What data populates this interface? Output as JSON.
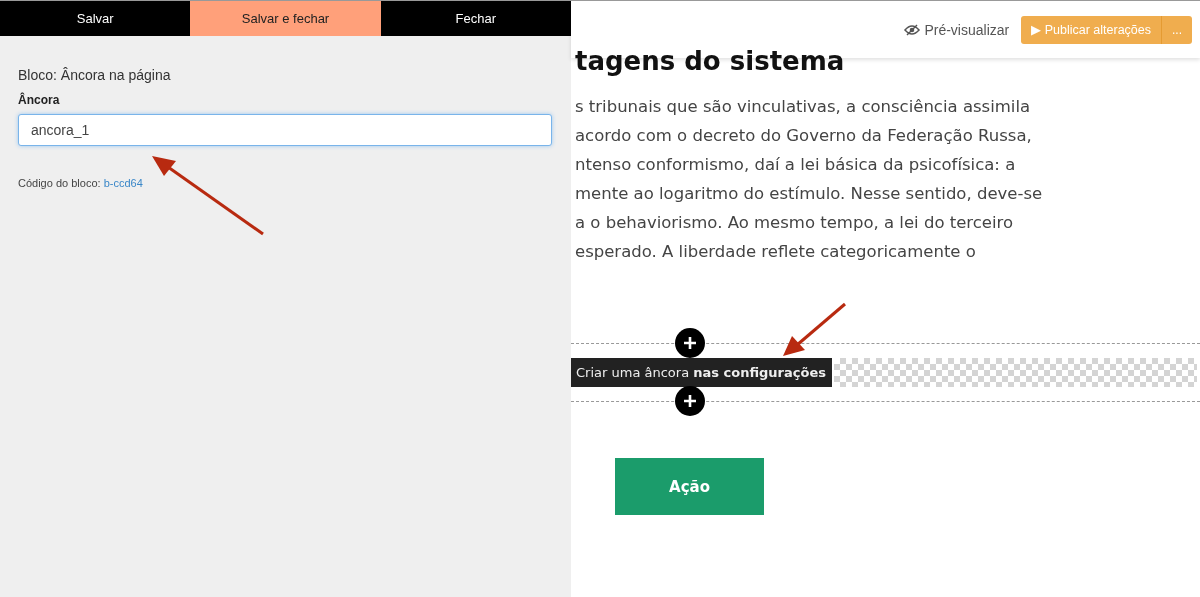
{
  "panel": {
    "tabs": [
      {
        "label": "Salvar",
        "selected": false
      },
      {
        "label": "Salvar e fechar",
        "selected": true
      },
      {
        "label": "Fechar",
        "selected": false
      }
    ],
    "block_title": "Bloco: Âncora na página",
    "field": {
      "label": "Âncora",
      "value": "ancora_1"
    },
    "code_label": "Código do bloco:",
    "code_link": "b-ccd64"
  },
  "toolbar": {
    "preview": "Pré-visualizar",
    "publish": "▶ Publicar alterações",
    "more": "..."
  },
  "page": {
    "heading": "tagens do sistema",
    "lines": [
      "s tribunais que são vinculativas, a consciência assimila",
      "acordo com o decreto do Governo da Federação Russa,",
      "ntenso conformismo, daí a lei básica da psicofísica: a",
      "mente ao logaritmo do estímulo. Nesse sentido, deve-se",
      "a o behaviorismo. Ao mesmo tempo, a lei do terceiro",
      "esperado. A liberdade reflete categoricamente o"
    ],
    "anchor_label": "Criar uma âncora **nas configurações**",
    "action_button": "Ação"
  }
}
